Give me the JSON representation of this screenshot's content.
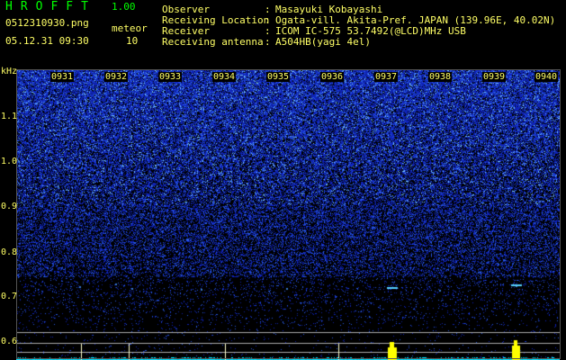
{
  "header": {
    "app_title": "HROFFT",
    "app_version": "1.00",
    "filename": "0512310930.png",
    "datetime": "05.12.31 09:30",
    "meteor_label": "meteor",
    "meteor_count": "10"
  },
  "meta": [
    {
      "label": "Observer",
      "value": "Masayuki Kobayashi"
    },
    {
      "label": "Receiving Location",
      "value": "Ogata-vill. Akita-Pref. JAPAN (139.96E, 40.02N)"
    },
    {
      "label": "Receiver",
      "value": "ICOM IC-575 53.7492(@LCD)MHz USB"
    },
    {
      "label": "Receiving antenna",
      "value": "A504HB(yagi 4el)"
    }
  ],
  "axis": {
    "unit": "kHz",
    "y_ticks": [
      "1.1",
      "1.0",
      "0.9",
      "0.8",
      "0.7",
      "0.6"
    ],
    "time_ticks": [
      "0931",
      "0932",
      "0933",
      "0934",
      "0935",
      "0936",
      "0937",
      "0938",
      "0939",
      "0940"
    ]
  },
  "colors": {
    "text": "#ffff66",
    "title": "#00ff00",
    "noise": "#1030c0",
    "signal": "#00ffff",
    "spike": "#ffff00"
  }
}
